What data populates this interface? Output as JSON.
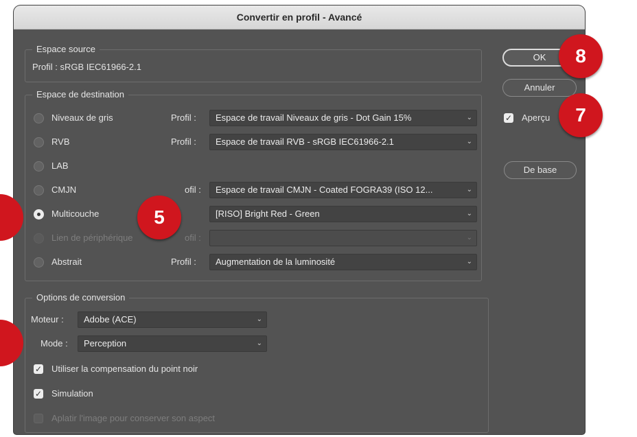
{
  "dialog": {
    "title": "Convertir en profil - Avancé"
  },
  "source": {
    "legend": "Espace source",
    "profile_text": "Profil : sRGB IEC61966-2.1"
  },
  "destination": {
    "legend": "Espace de destination",
    "profile_label": "Profil :",
    "options": [
      {
        "label": "Niveaux de gris",
        "profile": "Espace de travail Niveaux de gris - Dot Gain 15%",
        "selected": false,
        "enabled": true
      },
      {
        "label": "RVB",
        "profile": "Espace de travail RVB - sRGB IEC61966-2.1",
        "selected": false,
        "enabled": true
      },
      {
        "label": "LAB",
        "profile": "",
        "selected": false,
        "enabled": true
      },
      {
        "label": "CMJN",
        "profile": "Espace de travail CMJN - Coated FOGRA39 (ISO 12...",
        "selected": false,
        "enabled": true
      },
      {
        "label": "Multicouche",
        "profile": "[RISO] Bright Red - Green",
        "selected": true,
        "enabled": true
      },
      {
        "label": "Lien de périphérique",
        "profile": "",
        "selected": false,
        "enabled": false
      },
      {
        "label": "Abstrait",
        "profile": "Augmentation de la luminosité",
        "selected": false,
        "enabled": true
      }
    ],
    "profil_partial": "ofil :",
    "profil_partial_dim": "ofil :"
  },
  "conversion": {
    "legend": "Options de conversion",
    "engine_label": "Moteur :",
    "engine_value": "Adobe (ACE)",
    "mode_label": "Mode :",
    "mode_value": "Perception",
    "black_point": "Utiliser la compensation du point noir",
    "simulation": "Simulation",
    "flatten": "Aplatir l'image pour conserver son aspect"
  },
  "buttons": {
    "ok": "OK",
    "cancel": "Annuler",
    "preview": "Aperçu",
    "basic": "De base"
  },
  "badges": {
    "b5": "5",
    "b7": "7",
    "b8": "8"
  },
  "colors": {
    "badge": "#d0161e",
    "dialog_bg": "#535353"
  }
}
